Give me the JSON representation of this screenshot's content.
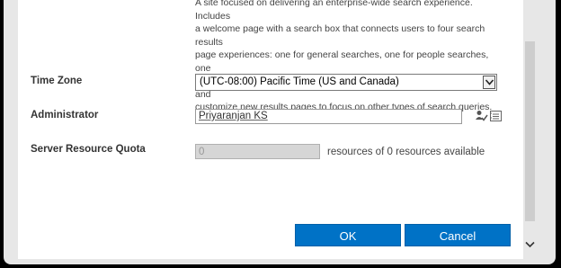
{
  "description": {
    "lines": [
      "A site focused on delivering an enterprise-wide search experience. Includes",
      "a welcome page with a search box that connects users to four search results",
      "page experiences: one for general searches, one for people searches, one",
      "for conversation searches, and one for video searches. You can add and",
      "customize new results pages to focus on other types of search queries."
    ]
  },
  "time_zone": {
    "label": "Time Zone",
    "selected": "(UTC-08:00) Pacific Time (US and Canada)",
    "dropdown_icon": "chevron-down-icon"
  },
  "administrator": {
    "label": "Administrator",
    "value": "Priyaranjan KS",
    "check_names_icon": "check-names-icon",
    "browse_icon": "address-book-icon"
  },
  "quota": {
    "label": "Server Resource Quota",
    "value": "0",
    "suffix": "resources of 0 resources available"
  },
  "buttons": {
    "ok_label": "OK",
    "cancel_label": "Cancel"
  },
  "colors": {
    "button_blue": "#0072c6",
    "background": "#ffffff",
    "frame": "#e7e7e7"
  }
}
